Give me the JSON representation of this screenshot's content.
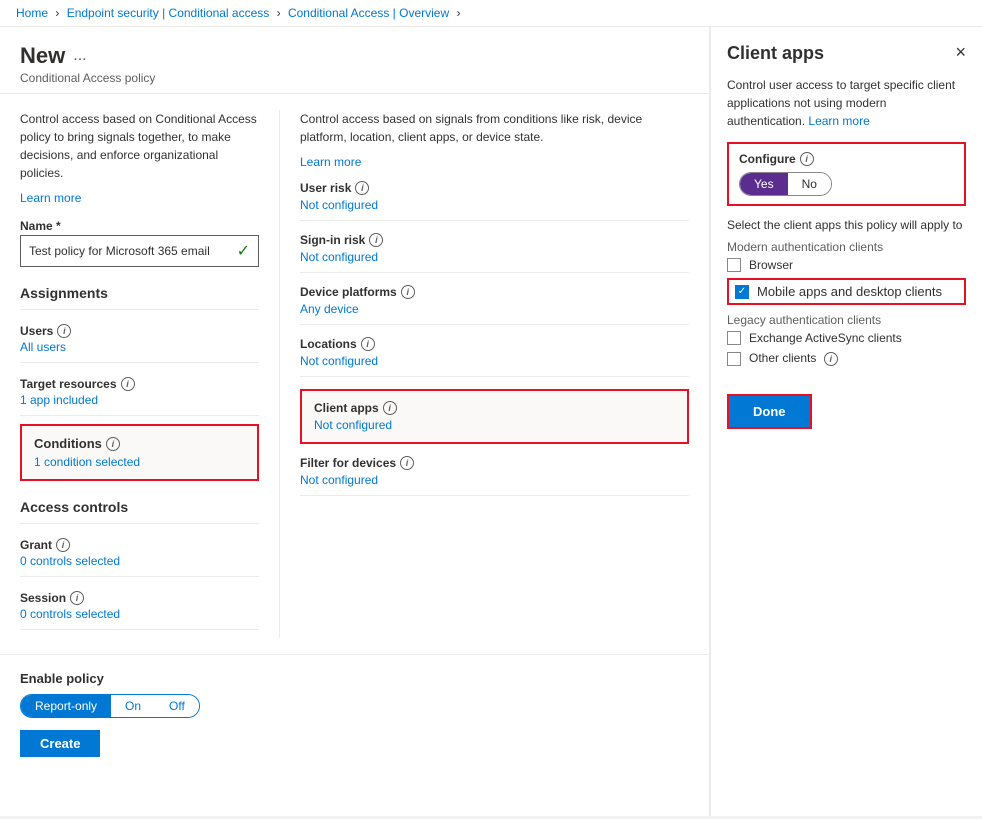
{
  "breadcrumbs": {
    "home": "Home",
    "endpoint": "Endpoint security | Conditional access",
    "overview": "Conditional Access | Overview",
    "sep": "›"
  },
  "page": {
    "title": "New",
    "ellipsis": "...",
    "subtitle": "Conditional Access policy"
  },
  "left_col": {
    "desc": "Control access based on Conditional Access policy to bring signals together, to make decisions, and enforce organizational policies.",
    "learn_more": "Learn more",
    "name_label": "Name *",
    "name_value": "Test policy for Microsoft 365 email",
    "assignments_title": "Assignments",
    "users_label": "Users",
    "users_info": "i",
    "users_value": "All users",
    "target_resources_label": "Target resources",
    "target_resources_info": "i",
    "target_resources_value": "1 app included",
    "conditions_label": "Conditions",
    "conditions_info": "i",
    "conditions_value": "1 condition selected",
    "access_controls_title": "Access controls",
    "grant_label": "Grant",
    "grant_info": "i",
    "grant_value": "0 controls selected",
    "session_label": "Session",
    "session_info": "i",
    "session_value": "0 controls selected"
  },
  "right_col": {
    "desc": "Control access based on signals from conditions like risk, device platform, location, client apps, or device state.",
    "learn_more": "Learn more",
    "user_risk_label": "User risk",
    "user_risk_info": "i",
    "user_risk_value": "Not configured",
    "sign_in_risk_label": "Sign-in risk",
    "sign_in_risk_info": "i",
    "sign_in_risk_value": "Not configured",
    "device_platforms_label": "Device platforms",
    "device_platforms_info": "i",
    "device_platforms_value": "Any device",
    "locations_label": "Locations",
    "locations_info": "i",
    "locations_value": "Not configured",
    "client_apps_label": "Client apps",
    "client_apps_info": "i",
    "client_apps_value": "Not configured",
    "filter_devices_label": "Filter for devices",
    "filter_devices_info": "i",
    "filter_devices_value": "Not configured"
  },
  "enable_policy": {
    "label": "Enable policy",
    "report_only": "Report-only",
    "on": "On",
    "off": "Off"
  },
  "buttons": {
    "create": "Create"
  },
  "client_apps_panel": {
    "title": "Client apps",
    "desc": "Control user access to target specific client applications not using modern authentication.",
    "learn_more": "Learn more",
    "configure_label": "Configure",
    "configure_info": "i",
    "yes": "Yes",
    "no": "No",
    "select_label": "Select the client apps this policy will apply to",
    "modern_auth_label": "Modern authentication clients",
    "browser_label": "Browser",
    "mobile_apps_label": "Mobile apps and desktop clients",
    "legacy_auth_label": "Legacy authentication clients",
    "exchange_label": "Exchange ActiveSync clients",
    "other_clients_label": "Other clients",
    "other_clients_info": "i",
    "done_label": "Done"
  }
}
